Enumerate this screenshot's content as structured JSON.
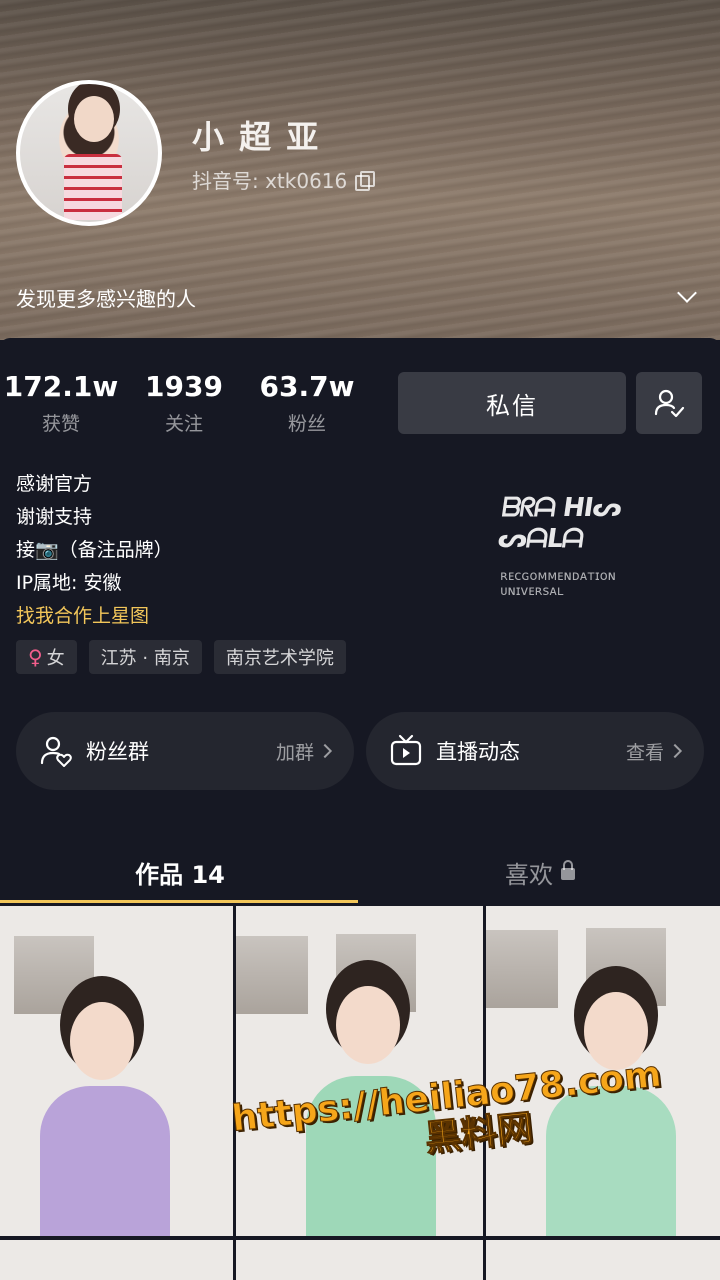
{
  "profile": {
    "name": "小 超 亚",
    "douyin_id": "抖音号: xtk0616",
    "discover": "发现更多感兴趣的人"
  },
  "stats": [
    {
      "value": "172.1w",
      "label": "获赞"
    },
    {
      "value": "1939",
      "label": "关注"
    },
    {
      "value": "63.7w",
      "label": "粉丝"
    }
  ],
  "actions": {
    "message": "私信"
  },
  "bio": {
    "line1": "感谢官方",
    "line2": "谢谢支持",
    "line3": "接📷（备注品牌）",
    "line4": "IP属地: 安徽",
    "link": "找我合作上星图"
  },
  "signature": {
    "line1": "ᗷᖇᗩ ᕼIᔕ ᔕᗩᒪᗩ",
    "line2": "ʀᴇᴄɢᴏᴍᴍᴇɴᴅᴀᴛɪᴏɴ ᴜɴɪᴠᴇʀsᴀʟ"
  },
  "tags": {
    "gender": "女",
    "location": "江苏 · 南京",
    "school": "南京艺术学院"
  },
  "cards": {
    "fans": {
      "title": "粉丝群",
      "action": "加群"
    },
    "live": {
      "title": "直播动态",
      "action": "查看"
    }
  },
  "tabs": {
    "works": "作品 14",
    "likes": "喜欢"
  },
  "watermark": {
    "url": "https://heiliao78.com",
    "name": "黑料网"
  },
  "colors": {
    "background": "#161823",
    "accent": "#f2c65a",
    "button": "#393b44",
    "gender_female": "#f25e8c"
  }
}
